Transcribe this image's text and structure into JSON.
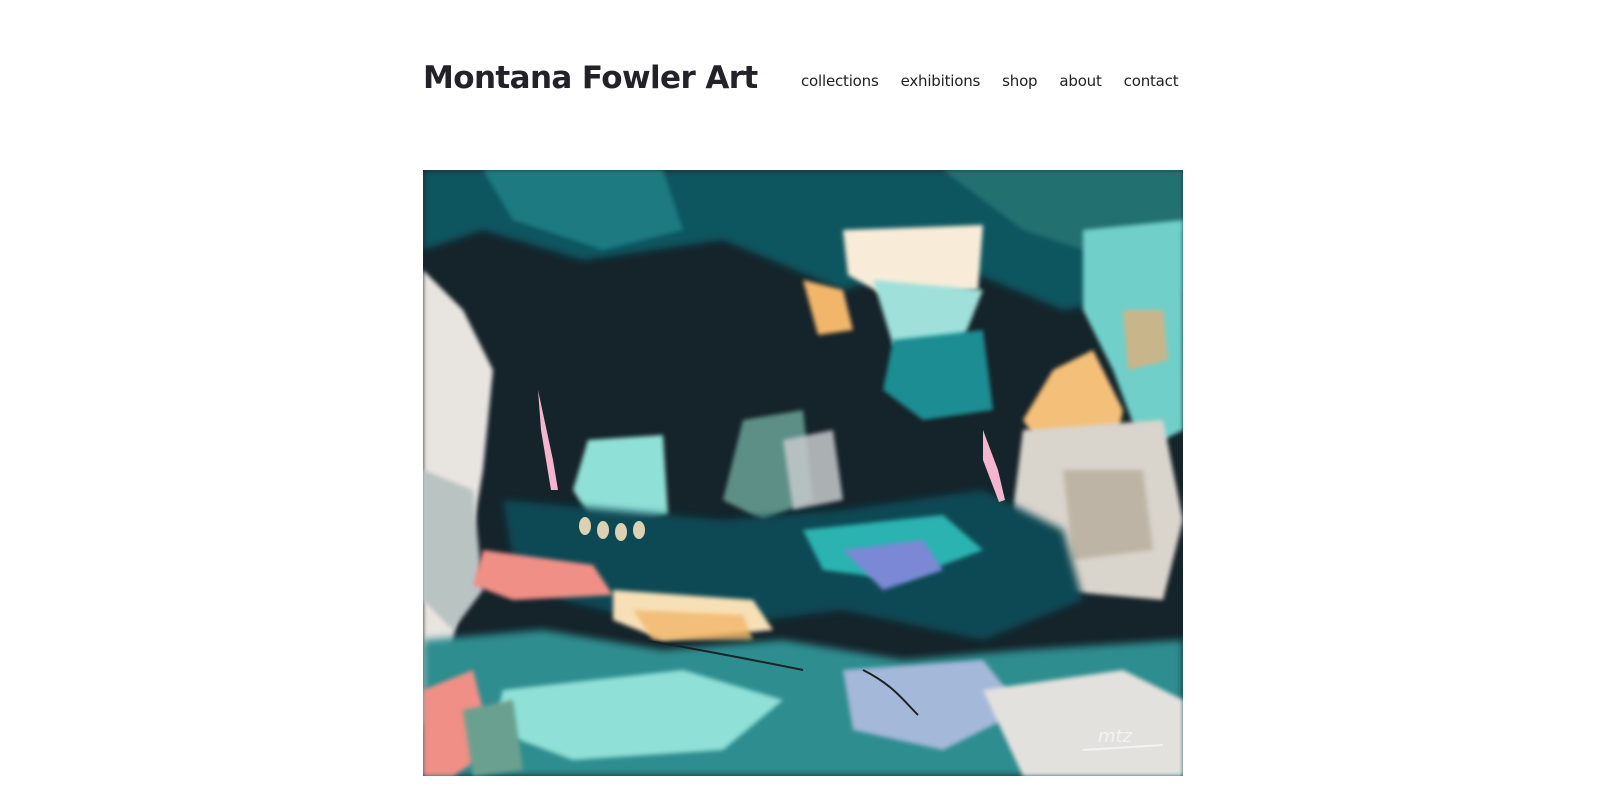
{
  "header": {
    "site_title": "Montana Fowler Art"
  },
  "nav": {
    "items": [
      {
        "label": "collections"
      },
      {
        "label": "exhibitions"
      },
      {
        "label": "shop"
      },
      {
        "label": "about"
      },
      {
        "label": "contact"
      }
    ]
  },
  "main": {
    "featured_artwork": {
      "type": "abstract painting",
      "signature": "mtz"
    }
  },
  "colors": {
    "background": "#ffffff",
    "text": "#1f1f24",
    "painting_palette": [
      "#1b2a30",
      "#0e4a55",
      "#2fb0ad",
      "#8fe0d6",
      "#f2b66a",
      "#f08f86",
      "#f4d9e6",
      "#e8e8e8"
    ]
  }
}
